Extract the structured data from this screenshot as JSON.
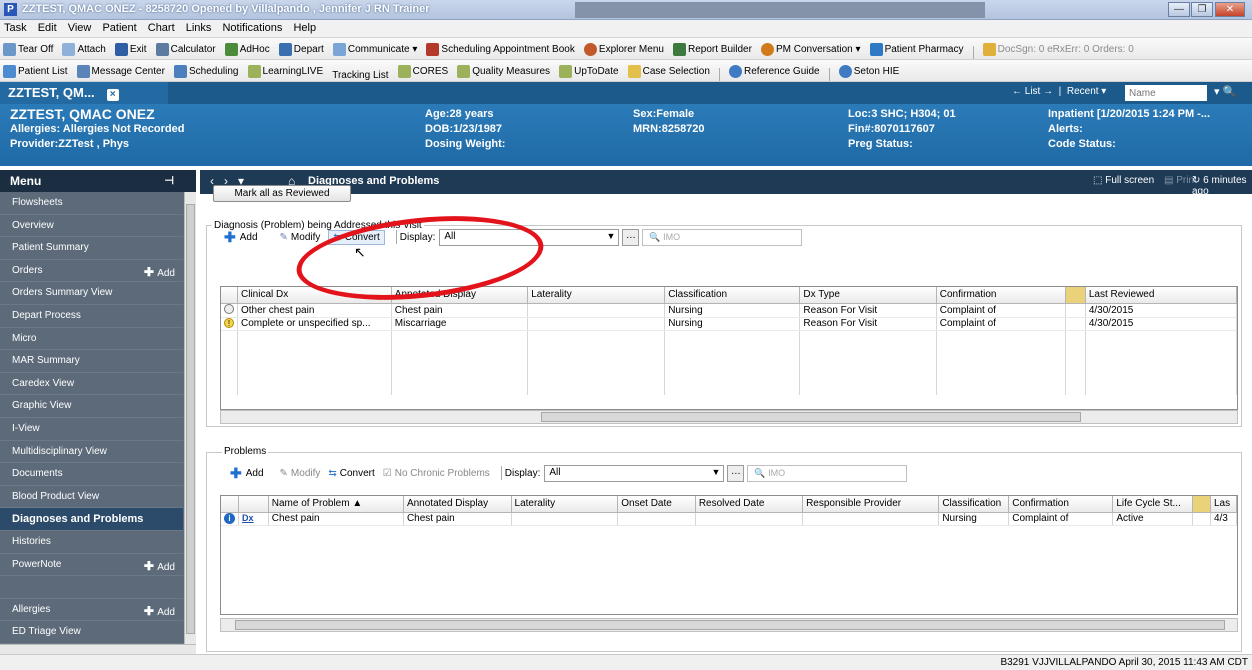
{
  "window": {
    "title": "ZZTEST, QMAC ONEZ - 8258720 Opened by Villalpando , Jennifer J RN Trainer",
    "app_icon": "P"
  },
  "menubar": [
    "Task",
    "Edit",
    "View",
    "Patient",
    "Chart",
    "Links",
    "Notifications",
    "Help"
  ],
  "toolbar1": {
    "items": [
      "Tear Off",
      "Attach",
      "Exit",
      "Calculator",
      "AdHoc",
      "Depart",
      "Communicate ▾",
      "Scheduling Appointment Book",
      "Explorer Menu",
      "Report Builder",
      "PM Conversation ▾",
      "Patient Pharmacy"
    ],
    "counters": "DocSgn: 0  eRxErr: 0  Orders: 0"
  },
  "toolbar2": {
    "items": [
      "Patient List",
      "Message Center",
      "Scheduling",
      "LearningLIVE",
      "Tracking List",
      "CORES",
      "Quality Measures",
      "UpToDate",
      "Case Selection",
      "Reference Guide",
      "Seton HIE"
    ]
  },
  "patient_tab": {
    "label": "ZZTEST, QM...",
    "close": "×",
    "list_label": "← List →",
    "recent_label": "Recent ▾",
    "name_placeholder": "Name",
    "search_glyph": "▾ 🔍"
  },
  "banner": {
    "name": "ZZTEST, QMAC ONEZ",
    "allergies": "Allergies: Allergies Not Recorded",
    "provider": "Provider:ZZTest , Phys",
    "age": "Age:28 years",
    "dob": "DOB:1/23/1987",
    "dosing": "Dosing Weight:",
    "sex": "Sex:Female",
    "mrn": "MRN:8258720",
    "loc": "Loc:3 SHC; H304; 01",
    "fin": "Fin#:8070117607",
    "preg": "Preg Status:",
    "inpatient": "Inpatient [1/20/2015 1:24 PM -...",
    "alerts": "Alerts:",
    "code": "Code Status:"
  },
  "left_menu": {
    "title": "Menu",
    "pin": "⊣",
    "items": [
      {
        "label": "Flowsheets",
        "add": ""
      },
      {
        "label": "Overview",
        "add": ""
      },
      {
        "label": "Patient Summary",
        "add": ""
      },
      {
        "label": "Orders",
        "add": "Add"
      },
      {
        "label": "Orders Summary View",
        "add": ""
      },
      {
        "label": "Depart Process",
        "add": ""
      },
      {
        "label": "Micro",
        "add": ""
      },
      {
        "label": "MAR Summary",
        "add": ""
      },
      {
        "label": "Caredex View",
        "add": ""
      },
      {
        "label": "Graphic View",
        "add": ""
      },
      {
        "label": "I-View",
        "add": ""
      },
      {
        "label": "Multidisciplinary View",
        "add": ""
      },
      {
        "label": "Documents",
        "add": ""
      },
      {
        "label": "Blood Product View",
        "add": ""
      },
      {
        "label": "Diagnoses and Problems",
        "add": ""
      },
      {
        "label": "Histories",
        "add": ""
      },
      {
        "label": "PowerNote",
        "add": "Add"
      },
      {
        "label": "",
        "add": ""
      },
      {
        "label": "Allergies",
        "add": "Add"
      },
      {
        "label": "ED Triage View",
        "add": ""
      }
    ],
    "active_index": 14
  },
  "content_header": {
    "title": "Diagnoses and Problems",
    "full_screen": "Full screen",
    "print": "Print",
    "refreshed": "6 minutes ago"
  },
  "mark_reviewed": "Mark all as Reviewed",
  "diagnosis": {
    "section_title": "Diagnosis (Problem) being Addressed this Visit",
    "add": "Add",
    "modify": "Modify",
    "convert": "Convert",
    "display_label": "Display:",
    "display_value": "All",
    "imo": "IMO",
    "columns": [
      "",
      "Clinical Dx",
      "Annotated Display",
      "Laterality",
      "Classification",
      "Dx Type",
      "Confirmation",
      "",
      "Last Reviewed"
    ],
    "rows": [
      {
        "icon": "circle",
        "clinical": "Other chest pain",
        "annotated": "Chest pain",
        "laterality": "",
        "classification": "Nursing",
        "dxtype": "Reason For Visit",
        "confirmation": "Complaint of",
        "flag": "",
        "reviewed": "4/30/2015"
      },
      {
        "icon": "warn",
        "clinical": "Complete or unspecified sp...",
        "annotated": "Miscarriage",
        "laterality": "",
        "classification": "Nursing",
        "dxtype": "Reason For Visit",
        "confirmation": "Complaint of",
        "flag": "",
        "reviewed": "4/30/2015"
      }
    ]
  },
  "problems": {
    "section_title": "Problems",
    "add": "Add",
    "modify": "Modify",
    "convert": "Convert",
    "no_chronic": "No Chronic Problems",
    "display_label": "Display:",
    "display_value": "All",
    "imo": "IMO",
    "columns": [
      "",
      "",
      "Name of Problem ▲",
      "Annotated Display",
      "Laterality",
      "Onset Date",
      "Resolved Date",
      "Responsible Provider",
      "Classification",
      "Confirmation",
      "Life Cycle St...",
      "",
      "Las"
    ],
    "rows": [
      {
        "name": "Chest pain",
        "annotated": "Chest pain",
        "laterality": "",
        "onset": "",
        "resolved": "",
        "provider": "",
        "classification": "Nursing",
        "confirmation": "Complaint of",
        "lifecycle": "Active",
        "flag": "",
        "last": "4/3"
      }
    ]
  },
  "status_bar": "B3291  VJJVILLALPANDO  April 30, 2015  11:43 AM CDT",
  "colors": {
    "banner": "#2b7bb8",
    "left_menu": "#5c6a79",
    "content_header": "#1f3a55",
    "annotation_circle": "#e3131b"
  }
}
